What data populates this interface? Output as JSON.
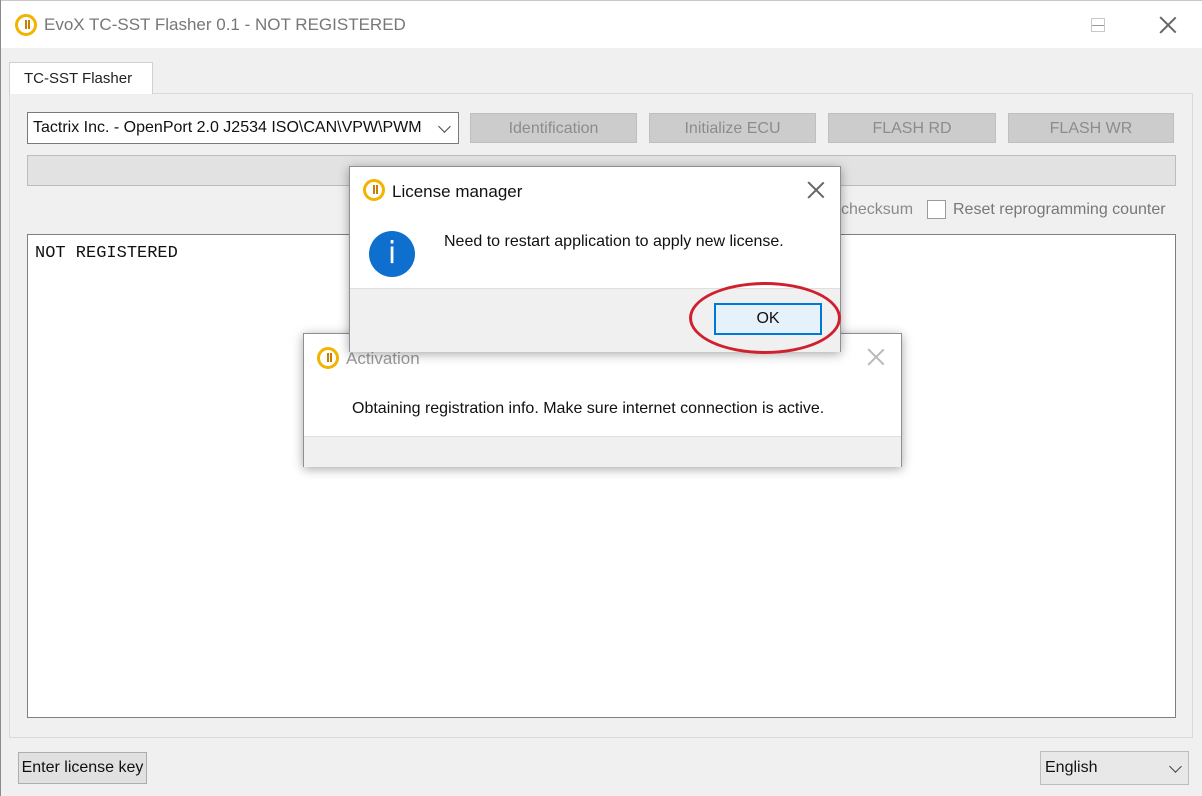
{
  "window": {
    "title": "EvoX TC-SST Flasher 0.1 - NOT REGISTERED"
  },
  "tabs": [
    {
      "label": "TC-SST Flasher"
    }
  ],
  "toolbar": {
    "device_select_value": "Tactrix Inc. - OpenPort 2.0 J2534 ISO\\CAN\\VPW\\PWM",
    "identification_label": "Identification",
    "initialize_ecu_label": "Initialize ECU",
    "flash_rd_label": "FLASH RD",
    "flash_wr_label": "FLASH WR"
  },
  "options": {
    "checksum_label": "checksum",
    "reset_counter_label": "Reset reprogramming counter"
  },
  "log": {
    "text": "NOT REGISTERED"
  },
  "footer": {
    "enter_license_key_label": "Enter license key",
    "language_value": "English"
  },
  "license_dialog": {
    "title": "License manager",
    "message": "Need to restart application to apply new license.",
    "ok_label": "OK",
    "highlight_color": "#d0202e"
  },
  "activation_dialog": {
    "title": "Activation",
    "message": "Obtaining registration info. Make sure internet connection is active."
  },
  "icons": {
    "app_icon": "app-icon",
    "info_icon": "info-icon",
    "info_glyph": "i"
  }
}
